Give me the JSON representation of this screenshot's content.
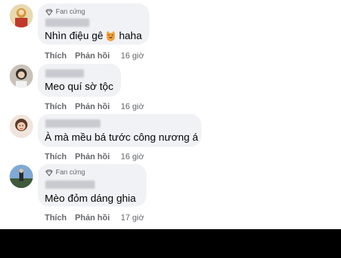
{
  "badge_label": "Fan cứng",
  "action_like": "Thích",
  "action_reply": "Phản hồi",
  "comments": [
    {
      "text_before": "Nhìn điệu gê",
      "emoji": "smiling-cat-emoji",
      "text_after": "haha",
      "time": "16 giờ"
    },
    {
      "text": "Meo quí sờ tộc",
      "time": "16 giờ"
    },
    {
      "text": "À mà mều bá tước công nương á",
      "time": "16 giờ"
    },
    {
      "text": "Mèo đỏm dáng ghia",
      "time": "17 giờ"
    }
  ]
}
